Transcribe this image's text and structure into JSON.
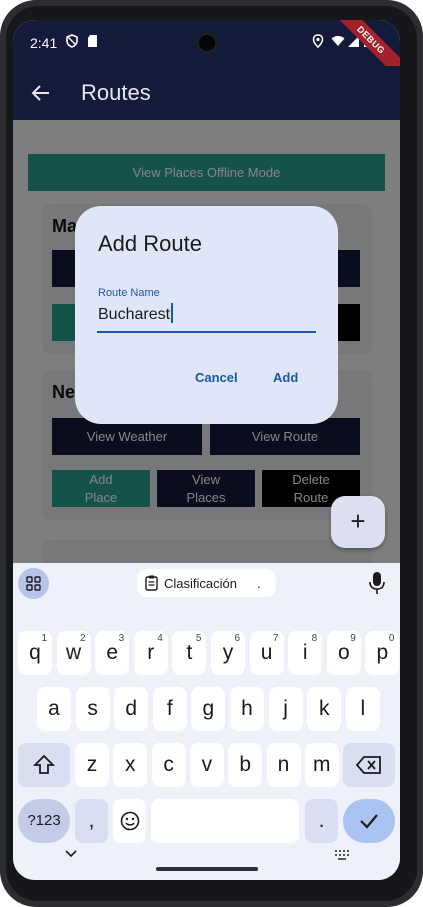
{
  "status_bar": {
    "time": "2:41",
    "debug_banner": "DEBUG"
  },
  "app_bar": {
    "title": "Routes"
  },
  "content": {
    "offline_button": "View Places Offline Mode",
    "card1": {
      "title_partial": "Ma"
    },
    "card2": {
      "title_partial": "Ne",
      "view_weather": "View Weather",
      "view_route": "View Route",
      "add_place": "Add Place",
      "view_places": "View Places",
      "delete_route": "Delete Route"
    },
    "fab": "+"
  },
  "dialog": {
    "title": "Add Route",
    "field_label": "Route Name",
    "field_value": "Bucharest",
    "cancel_label": "Cancel",
    "add_label": "Add"
  },
  "keyboard": {
    "suggestion": "Clasificación",
    "suggestion_extra": ".",
    "row1": [
      "q",
      "w",
      "e",
      "r",
      "t",
      "y",
      "u",
      "i",
      "o",
      "p"
    ],
    "row1_hints": [
      "1",
      "2",
      "3",
      "4",
      "5",
      "6",
      "7",
      "8",
      "9",
      "0"
    ],
    "row2": [
      "a",
      "s",
      "d",
      "f",
      "g",
      "h",
      "j",
      "k",
      "l"
    ],
    "row3": [
      "z",
      "x",
      "c",
      "v",
      "b",
      "n",
      "m"
    ],
    "symbols_key": "?123",
    "comma_key": ",",
    "period_key": "."
  },
  "colors": {
    "primary_navy": "#131a3a",
    "teal": "#2a9d8f",
    "dialog_bg": "#dfe6f7",
    "accent_blue": "#1e57a8",
    "debug_red": "#a1222b"
  }
}
